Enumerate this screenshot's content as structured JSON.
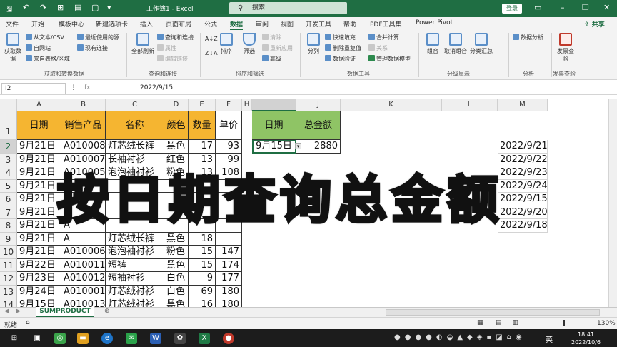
{
  "window": {
    "title": "工作簿1 - Excel",
    "search_placeholder": "搜索",
    "login": "登录"
  },
  "menu": {
    "items": [
      "文件",
      "开始",
      "模板中心",
      "新建选项卡",
      "插入",
      "页面布局",
      "公式",
      "数据",
      "审阅",
      "视图",
      "开发工具",
      "帮助",
      "PDF工具集",
      "Power Pivot"
    ],
    "active": "数据",
    "share": "共享"
  },
  "ribbon": {
    "get_data": "获取数据",
    "from_text_csv": "从文本/CSV",
    "from_web": "自网站",
    "from_table": "来自表格/区域",
    "recent_sources": "最近使用的源",
    "existing_conn": "现有连接",
    "refresh_all": "全部刷新",
    "queries_conn": "查询和连接",
    "properties": "属性",
    "edit_links": "编辑链接",
    "sort_az": "A↓Z",
    "sort_za": "Z↓A",
    "sort": "排序",
    "filter": "筛选",
    "clear": "清除",
    "reapply": "重新应用",
    "advanced": "高级",
    "split": "分列",
    "flash_fill": "快速填充",
    "remove_dup": "删除重复值",
    "validation": "数据验证",
    "consolidate": "合并计算",
    "relationships": "关系",
    "data_model": "管理数据模型",
    "group": "组合",
    "ungroup": "取消组合",
    "subtotal": "分类汇总",
    "data_analysis": "数据分析",
    "invoice": "发票查验",
    "groups": {
      "get_transform": "获取和转换数据",
      "queries": "查询和连接",
      "sort_filter": "排序和筛选",
      "data_tools": "数据工具",
      "outline": "分级显示",
      "analysis": "分析",
      "invoice": "发票查验"
    }
  },
  "formula_bar": {
    "namebox": "I2",
    "fx": "fx",
    "value": "2022/9/15"
  },
  "sheet": {
    "columns": [
      "A",
      "B",
      "C",
      "D",
      "E",
      "F",
      "H",
      "I",
      "J",
      "K",
      "L",
      "M"
    ],
    "row_numbers": [
      "1",
      "2",
      "3",
      "4",
      "5",
      "6",
      "7",
      "8",
      "9",
      "10",
      "11",
      "12",
      "13",
      "14"
    ],
    "table_headers": [
      "日期",
      "销售产品",
      "名称",
      "颜色",
      "数量",
      "单价"
    ],
    "rows": [
      [
        "9月21日",
        "A010008",
        "灯芯绒长裤",
        "黑色",
        "17",
        "93"
      ],
      [
        "9月21日",
        "A010007",
        "长袖衬衫",
        "红色",
        "13",
        "99"
      ],
      [
        "9月21日",
        "A010005",
        "泡泡袖衬衫",
        "粉色",
        "13",
        "108"
      ],
      [
        "9月21日",
        "A",
        "",
        "",
        "",
        ""
      ],
      [
        "9月21日",
        "A",
        "",
        "",
        "",
        ""
      ],
      [
        "9月21日",
        "A",
        "",
        "",
        "",
        ""
      ],
      [
        "9月21日",
        "A",
        "",
        "",
        "",
        ""
      ],
      [
        "9月21日",
        "A",
        "灯芯绒长裤",
        "黑色",
        "18",
        ""
      ],
      [
        "9月21日",
        "A010006",
        "泡泡袖衬衫",
        "粉色",
        "15",
        "147"
      ],
      [
        "9月22日",
        "A010011",
        "短裤",
        "黑色",
        "15",
        "174"
      ],
      [
        "9月23日",
        "A010012",
        "短袖衬衫",
        "白色",
        "9",
        "177"
      ],
      [
        "9月24日",
        "A010001",
        "灯芯绒衬衫",
        "白色",
        "69",
        "180"
      ],
      [
        "9月15日",
        "A010013",
        "灯芯绒衬衫",
        "黑色",
        "16",
        "180"
      ]
    ],
    "lookup_headers": [
      "日期",
      "总金额"
    ],
    "lookup_date": "9月15日",
    "lookup_total": "2880",
    "m_dates": [
      "2022/9/21",
      "2022/9/22",
      "2022/9/23",
      "2022/9/24",
      "2022/9/15",
      "2022/9/20",
      "2022/9/18"
    ]
  },
  "banner_text": "按日期查询总金额",
  "tabs": {
    "sheet_name": "SUMPRODUCT",
    "add": "⊕"
  },
  "status": {
    "ready": "就绪",
    "zoom": "130%"
  },
  "taskbar": {
    "time": "18:41",
    "date": "2022/10/6",
    "lang": "英"
  }
}
